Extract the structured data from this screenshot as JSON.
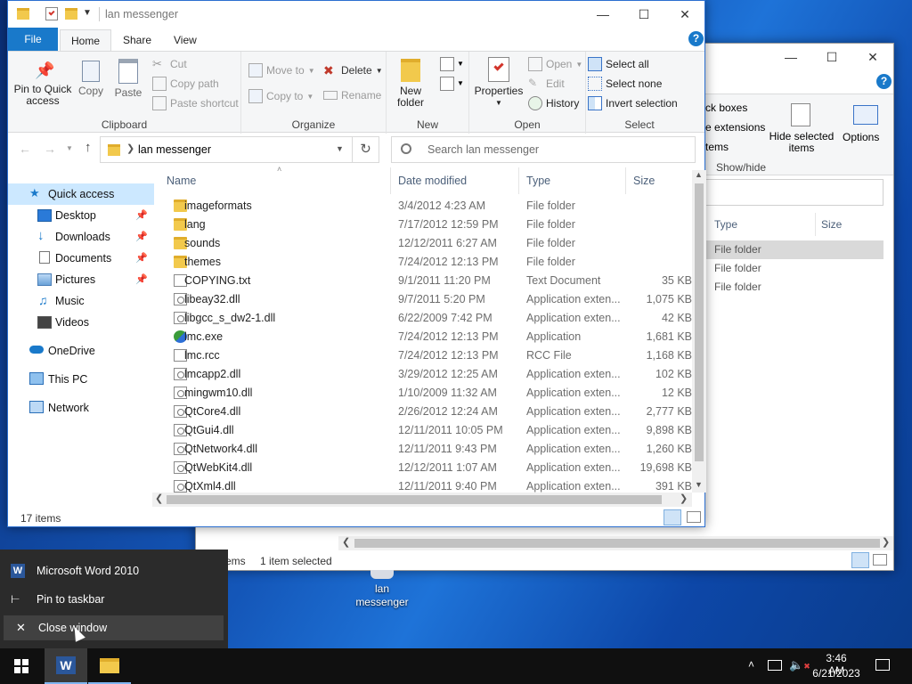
{
  "back_window": {
    "ribbon_items": [
      "ck boxes",
      "e extensions",
      "tems"
    ],
    "hide_selected": "Hide selected items",
    "options": "Options",
    "group_label": "Show/hide",
    "columns": {
      "type": "Type",
      "size": "Size"
    },
    "rows": [
      "File folder",
      "File folder",
      "File folder"
    ],
    "status_items": "ems",
    "status_selected": "1 item selected",
    "controls": {
      "minimize": "—",
      "maximize": "☐",
      "close": "✕"
    }
  },
  "window": {
    "title": "lan messenger",
    "controls": {
      "minimize": "—",
      "maximize": "☐",
      "close": "✕"
    },
    "tabs": {
      "file": "File",
      "home": "Home",
      "share": "Share",
      "view": "View"
    },
    "ribbon": {
      "clipboard": {
        "pin": "Pin to Quick access",
        "copy": "Copy",
        "paste": "Paste",
        "cut": "Cut",
        "copy_path": "Copy path",
        "paste_shortcut": "Paste shortcut",
        "label": "Clipboard"
      },
      "organize": {
        "move_to": "Move to",
        "copy_to": "Copy to",
        "delete": "Delete",
        "rename": "Rename",
        "label": "Organize"
      },
      "new": {
        "new_folder": "New folder",
        "label": "New"
      },
      "open": {
        "properties": "Properties",
        "open": "Open",
        "edit": "Edit",
        "history": "History",
        "label": "Open"
      },
      "select": {
        "select_all": "Select all",
        "select_none": "Select none",
        "invert": "Invert selection",
        "label": "Select"
      }
    },
    "address": {
      "path": "lan messenger",
      "search_placeholder": "Search lan messenger"
    },
    "nav": {
      "quick_access": "Quick access",
      "items": [
        {
          "label": "Desktop",
          "pinned": true
        },
        {
          "label": "Downloads",
          "pinned": true
        },
        {
          "label": "Documents",
          "pinned": true
        },
        {
          "label": "Pictures",
          "pinned": true
        },
        {
          "label": "Music",
          "pinned": false
        },
        {
          "label": "Videos",
          "pinned": false
        }
      ],
      "onedrive": "OneDrive",
      "this_pc": "This PC",
      "network": "Network"
    },
    "columns": {
      "name": "Name",
      "date": "Date modified",
      "type": "Type",
      "size": "Size"
    },
    "files": [
      {
        "name": "imageformats",
        "date": "3/4/2012 4:23 AM",
        "type": "File folder",
        "size": "",
        "icon": "folder-icon"
      },
      {
        "name": "lang",
        "date": "7/17/2012 12:59 PM",
        "type": "File folder",
        "size": "",
        "icon": "folder-icon"
      },
      {
        "name": "sounds",
        "date": "12/12/2011 6:27 AM",
        "type": "File folder",
        "size": "",
        "icon": "folder-icon"
      },
      {
        "name": "themes",
        "date": "7/24/2012 12:13 PM",
        "type": "File folder",
        "size": "",
        "icon": "folder-icon"
      },
      {
        "name": "COPYING.txt",
        "date": "9/1/2011 11:20 PM",
        "type": "Text Document",
        "size": "35 KB",
        "icon": "text-file-icon"
      },
      {
        "name": "libeay32.dll",
        "date": "9/7/2011 5:20 PM",
        "type": "Application exten...",
        "size": "1,075 KB",
        "icon": "dll-file-icon"
      },
      {
        "name": "libgcc_s_dw2-1.dll",
        "date": "6/22/2009 7:42 PM",
        "type": "Application exten...",
        "size": "42 KB",
        "icon": "dll-file-icon"
      },
      {
        "name": "lmc.exe",
        "date": "7/24/2012 12:13 PM",
        "type": "Application",
        "size": "1,681 KB",
        "icon": "exe-icon"
      },
      {
        "name": "lmc.rcc",
        "date": "7/24/2012 12:13 PM",
        "type": "RCC File",
        "size": "1,168 KB",
        "icon": "blank-file-icon"
      },
      {
        "name": "lmcapp2.dll",
        "date": "3/29/2012 12:25 AM",
        "type": "Application exten...",
        "size": "102 KB",
        "icon": "dll-file-icon"
      },
      {
        "name": "mingwm10.dll",
        "date": "1/10/2009 11:32 AM",
        "type": "Application exten...",
        "size": "12 KB",
        "icon": "dll-file-icon"
      },
      {
        "name": "QtCore4.dll",
        "date": "2/26/2012 12:24 AM",
        "type": "Application exten...",
        "size": "2,777 KB",
        "icon": "dll-file-icon"
      },
      {
        "name": "QtGui4.dll",
        "date": "12/11/2011 10:05 PM",
        "type": "Application exten...",
        "size": "9,898 KB",
        "icon": "dll-file-icon"
      },
      {
        "name": "QtNetwork4.dll",
        "date": "12/11/2011 9:43 PM",
        "type": "Application exten...",
        "size": "1,260 KB",
        "icon": "dll-file-icon"
      },
      {
        "name": "QtWebKit4.dll",
        "date": "12/12/2011 1:07 AM",
        "type": "Application exten...",
        "size": "19,698 KB",
        "icon": "dll-file-icon"
      },
      {
        "name": "QtXml4.dll",
        "date": "12/11/2011 9:40 PM",
        "type": "Application exten...",
        "size": "391 KB",
        "icon": "dll-file-icon"
      }
    ],
    "status": "17 items"
  },
  "desktop_icon": {
    "label": "lan messenger"
  },
  "jumplist": {
    "app": "Microsoft Word 2010",
    "pin": "Pin to taskbar",
    "close": "Close window"
  },
  "taskbar": {
    "time": "3:46 AM",
    "date": "6/21/2023"
  },
  "colors": {
    "accent": "#1979ca",
    "file_tab": "#1979ca",
    "selected_nav": "#cce8ff"
  }
}
